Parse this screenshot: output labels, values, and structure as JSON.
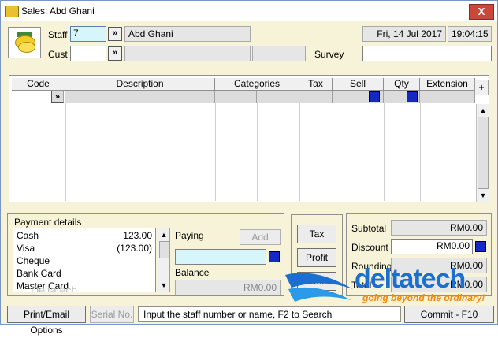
{
  "window": {
    "title": "Sales:  Abd  Ghani",
    "close_label": "X"
  },
  "header": {
    "staff_label": "Staff",
    "staff_value": "7",
    "staff_name": "Abd  Ghani",
    "cust_label": "Cust",
    "cust_value": "",
    "survey_label": "Survey",
    "survey_value": "",
    "date": "Fri, 14 Jul 2017",
    "time": "19:04:15",
    "lookup_label": "»"
  },
  "grid": {
    "columns": [
      "Code",
      "Description",
      "Categories",
      "Tax",
      "Sell",
      "Qty",
      "Extension"
    ],
    "add_label": "+",
    "row_lookup_label": "»"
  },
  "payment": {
    "title": "Payment details",
    "methods": [
      {
        "name": "Cash",
        "amount": "123.00"
      },
      {
        "name": "Visa",
        "amount": "(123.00)"
      },
      {
        "name": "Cheque",
        "amount": ""
      },
      {
        "name": "Bank Card",
        "amount": ""
      },
      {
        "name": "Master Card",
        "amount": ""
      }
    ],
    "paying_label": "Paying",
    "add_label": "Add",
    "paying_value": "",
    "balance_label": "Balance",
    "balance_value": "RM0.00",
    "list_watermark": "Deltatech"
  },
  "actions": {
    "tax_label": "Tax",
    "profit_label": "Profit",
    "del_label": "Del"
  },
  "totals": {
    "subtotal_label": "Subtotal",
    "subtotal_value": "RM0.00",
    "discount_label": "Discount",
    "discount_value": "RM0.00",
    "rounding_label": "Rounding",
    "rounding_value": "RM0.00",
    "total_label": "Total",
    "total_value": "RM0.00"
  },
  "bottom": {
    "print_label": "Print/Email Options",
    "serial_label": "Serial No.",
    "status_text": "Input the staff number or name, F2 to Search",
    "commit_label": "Commit - F10"
  },
  "brand": {
    "name": "deltatech",
    "tagline": "going beyond the ordinary!"
  },
  "colors": {
    "panel_bg": "#f6f3d8",
    "accent_blue": "#1428c8",
    "close_red": "#c9483a",
    "input_cyan": "#d6f6fb"
  }
}
